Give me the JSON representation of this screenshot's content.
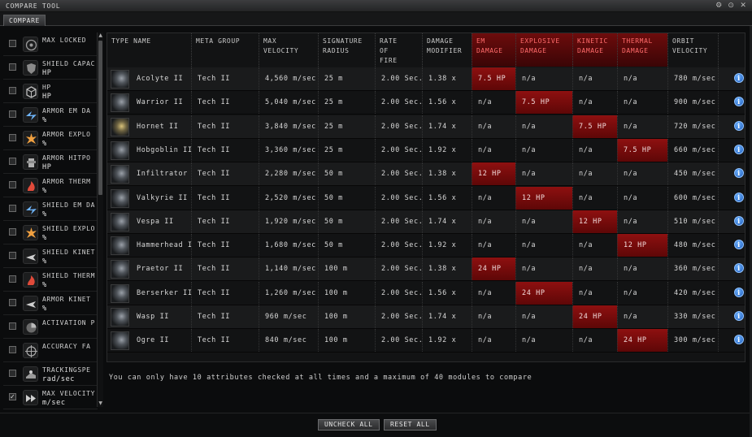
{
  "window": {
    "title": "COMPARE TOOL",
    "tab": "COMPARE"
  },
  "sidebar": {
    "items": [
      {
        "label": "MAX LOCKED",
        "unit": "",
        "checked": false,
        "icon": "target-icon"
      },
      {
        "label": "SHIELD CAPAC",
        "unit": "HP",
        "checked": false,
        "icon": "shield-icon"
      },
      {
        "label": "HP",
        "unit": "HP",
        "checked": false,
        "icon": "cube-icon"
      },
      {
        "label": "ARMOR EM DA",
        "unit": "%",
        "checked": false,
        "icon": "em-icon"
      },
      {
        "label": "ARMOR EXPLO",
        "unit": "%",
        "checked": false,
        "icon": "explosion-icon"
      },
      {
        "label": "ARMOR HITPO",
        "unit": "HP",
        "checked": false,
        "icon": "armor-icon"
      },
      {
        "label": "ARMOR THERM",
        "unit": "%",
        "checked": false,
        "icon": "thermal-icon"
      },
      {
        "label": "SHIELD EM DA",
        "unit": "%",
        "checked": false,
        "icon": "em-icon"
      },
      {
        "label": "SHIELD EXPLO",
        "unit": "%",
        "checked": false,
        "icon": "explosion-icon"
      },
      {
        "label": "SHIELD KINET",
        "unit": "%",
        "checked": false,
        "icon": "kinetic-icon"
      },
      {
        "label": "SHIELD THERM",
        "unit": "%",
        "checked": false,
        "icon": "thermal-icon"
      },
      {
        "label": "ARMOR KINET",
        "unit": "%",
        "checked": false,
        "icon": "kinetic-icon"
      },
      {
        "label": "ACTIVATION P",
        "unit": "",
        "checked": false,
        "icon": "activation-icon"
      },
      {
        "label": "ACCURACY FA",
        "unit": "",
        "checked": false,
        "icon": "crosshair-icon"
      },
      {
        "label": "TRACKINGSPE",
        "unit": "rad/sec",
        "checked": false,
        "icon": "tracking-icon"
      },
      {
        "label": "MAX VELOCITY",
        "unit": "m/sec",
        "checked": true,
        "icon": "velocity-icon"
      }
    ]
  },
  "table": {
    "columns": [
      {
        "label": "TYPE NAME",
        "red": false
      },
      {
        "label": "META GROUP",
        "red": false
      },
      {
        "label": "MAX\nVELOCITY",
        "red": false
      },
      {
        "label": "SIGNATURE\nRADIUS",
        "red": false
      },
      {
        "label": "RATE\nOF\nFIRE",
        "red": false
      },
      {
        "label": "DAMAGE\nMODIFIER",
        "red": false
      },
      {
        "label": "EM\nDAMAGE",
        "red": true
      },
      {
        "label": "EXPLOSIVE\nDAMAGE",
        "red": true
      },
      {
        "label": "KINETIC\nDAMAGE",
        "red": true
      },
      {
        "label": "THERMAL\nDAMAGE",
        "red": true
      },
      {
        "label": "ORBIT\nVELOCITY",
        "red": false
      }
    ],
    "rows": [
      {
        "name": "Acolyte II",
        "meta": "Tech II",
        "vel": "4,560 m/sec",
        "sig": "25 m",
        "rof": "2.00 Sec.",
        "dmg": "1.38 x",
        "em": "7.5 HP",
        "exp": "n/a",
        "kin": "n/a",
        "therm": "n/a",
        "orbit": "780 m/sec",
        "hl": "em",
        "img": "grey"
      },
      {
        "name": "Warrior II",
        "meta": "Tech II",
        "vel": "5,040 m/sec",
        "sig": "25 m",
        "rof": "2.00 Sec.",
        "dmg": "1.56 x",
        "em": "n/a",
        "exp": "7.5 HP",
        "kin": "n/a",
        "therm": "n/a",
        "orbit": "900 m/sec",
        "hl": "exp",
        "img": "grey"
      },
      {
        "name": "Hornet II",
        "meta": "Tech II",
        "vel": "3,840 m/sec",
        "sig": "25 m",
        "rof": "2.00 Sec.",
        "dmg": "1.74 x",
        "em": "n/a",
        "exp": "n/a",
        "kin": "7.5 HP",
        "therm": "n/a",
        "orbit": "720 m/sec",
        "hl": "kin",
        "img": "gold"
      },
      {
        "name": "Hobgoblin II",
        "meta": "Tech II",
        "vel": "3,360 m/sec",
        "sig": "25 m",
        "rof": "2.00 Sec.",
        "dmg": "1.92 x",
        "em": "n/a",
        "exp": "n/a",
        "kin": "n/a",
        "therm": "7.5 HP",
        "orbit": "660 m/sec",
        "hl": "therm",
        "img": "grey"
      },
      {
        "name": "Infiltrator II",
        "meta": "Tech II",
        "vel": "2,280 m/sec",
        "sig": "50 m",
        "rof": "2.00 Sec.",
        "dmg": "1.38 x",
        "em": "12 HP",
        "exp": "n/a",
        "kin": "n/a",
        "therm": "n/a",
        "orbit": "450 m/sec",
        "hl": "em",
        "img": "grey"
      },
      {
        "name": "Valkyrie II",
        "meta": "Tech II",
        "vel": "2,520 m/sec",
        "sig": "50 m",
        "rof": "2.00 Sec.",
        "dmg": "1.56 x",
        "em": "n/a",
        "exp": "12 HP",
        "kin": "n/a",
        "therm": "n/a",
        "orbit": "600 m/sec",
        "hl": "exp",
        "img": "grey"
      },
      {
        "name": "Vespa II",
        "meta": "Tech II",
        "vel": "1,920 m/sec",
        "sig": "50 m",
        "rof": "2.00 Sec.",
        "dmg": "1.74 x",
        "em": "n/a",
        "exp": "n/a",
        "kin": "12 HP",
        "therm": "n/a",
        "orbit": "510 m/sec",
        "hl": "kin",
        "img": "grey"
      },
      {
        "name": "Hammerhead II",
        "meta": "Tech II",
        "vel": "1,680 m/sec",
        "sig": "50 m",
        "rof": "2.00 Sec.",
        "dmg": "1.92 x",
        "em": "n/a",
        "exp": "n/a",
        "kin": "n/a",
        "therm": "12 HP",
        "orbit": "480 m/sec",
        "hl": "therm",
        "img": "grey"
      },
      {
        "name": "Praetor II",
        "meta": "Tech II",
        "vel": "1,140 m/sec",
        "sig": "100 m",
        "rof": "2.00 Sec.",
        "dmg": "1.38 x",
        "em": "24 HP",
        "exp": "n/a",
        "kin": "n/a",
        "therm": "n/a",
        "orbit": "360 m/sec",
        "hl": "em",
        "img": "grey"
      },
      {
        "name": "Berserker II",
        "meta": "Tech II",
        "vel": "1,260 m/sec",
        "sig": "100 m",
        "rof": "2.00 Sec.",
        "dmg": "1.56 x",
        "em": "n/a",
        "exp": "24 HP",
        "kin": "n/a",
        "therm": "n/a",
        "orbit": "420 m/sec",
        "hl": "exp",
        "img": "grey"
      },
      {
        "name": "Wasp II",
        "meta": "Tech II",
        "vel": "960 m/sec",
        "sig": "100 m",
        "rof": "2.00 Sec.",
        "dmg": "1.74 x",
        "em": "n/a",
        "exp": "n/a",
        "kin": "24 HP",
        "therm": "n/a",
        "orbit": "330 m/sec",
        "hl": "kin",
        "img": "grey"
      },
      {
        "name": "Ogre II",
        "meta": "Tech II",
        "vel": "840 m/sec",
        "sig": "100 m",
        "rof": "2.00 Sec.",
        "dmg": "1.92 x",
        "em": "n/a",
        "exp": "n/a",
        "kin": "n/a",
        "therm": "24 HP",
        "orbit": "300 m/sec",
        "hl": "therm",
        "img": "grey"
      }
    ]
  },
  "note": "You can only have 10 attributes checked at all times and a maximum of 40 modules to compare",
  "buttons": {
    "uncheck_all": "UNCHECK ALL",
    "reset_all": "RESET ALL"
  },
  "colors": {
    "highlight": "#8e1010",
    "info": "#2f7fe0"
  }
}
